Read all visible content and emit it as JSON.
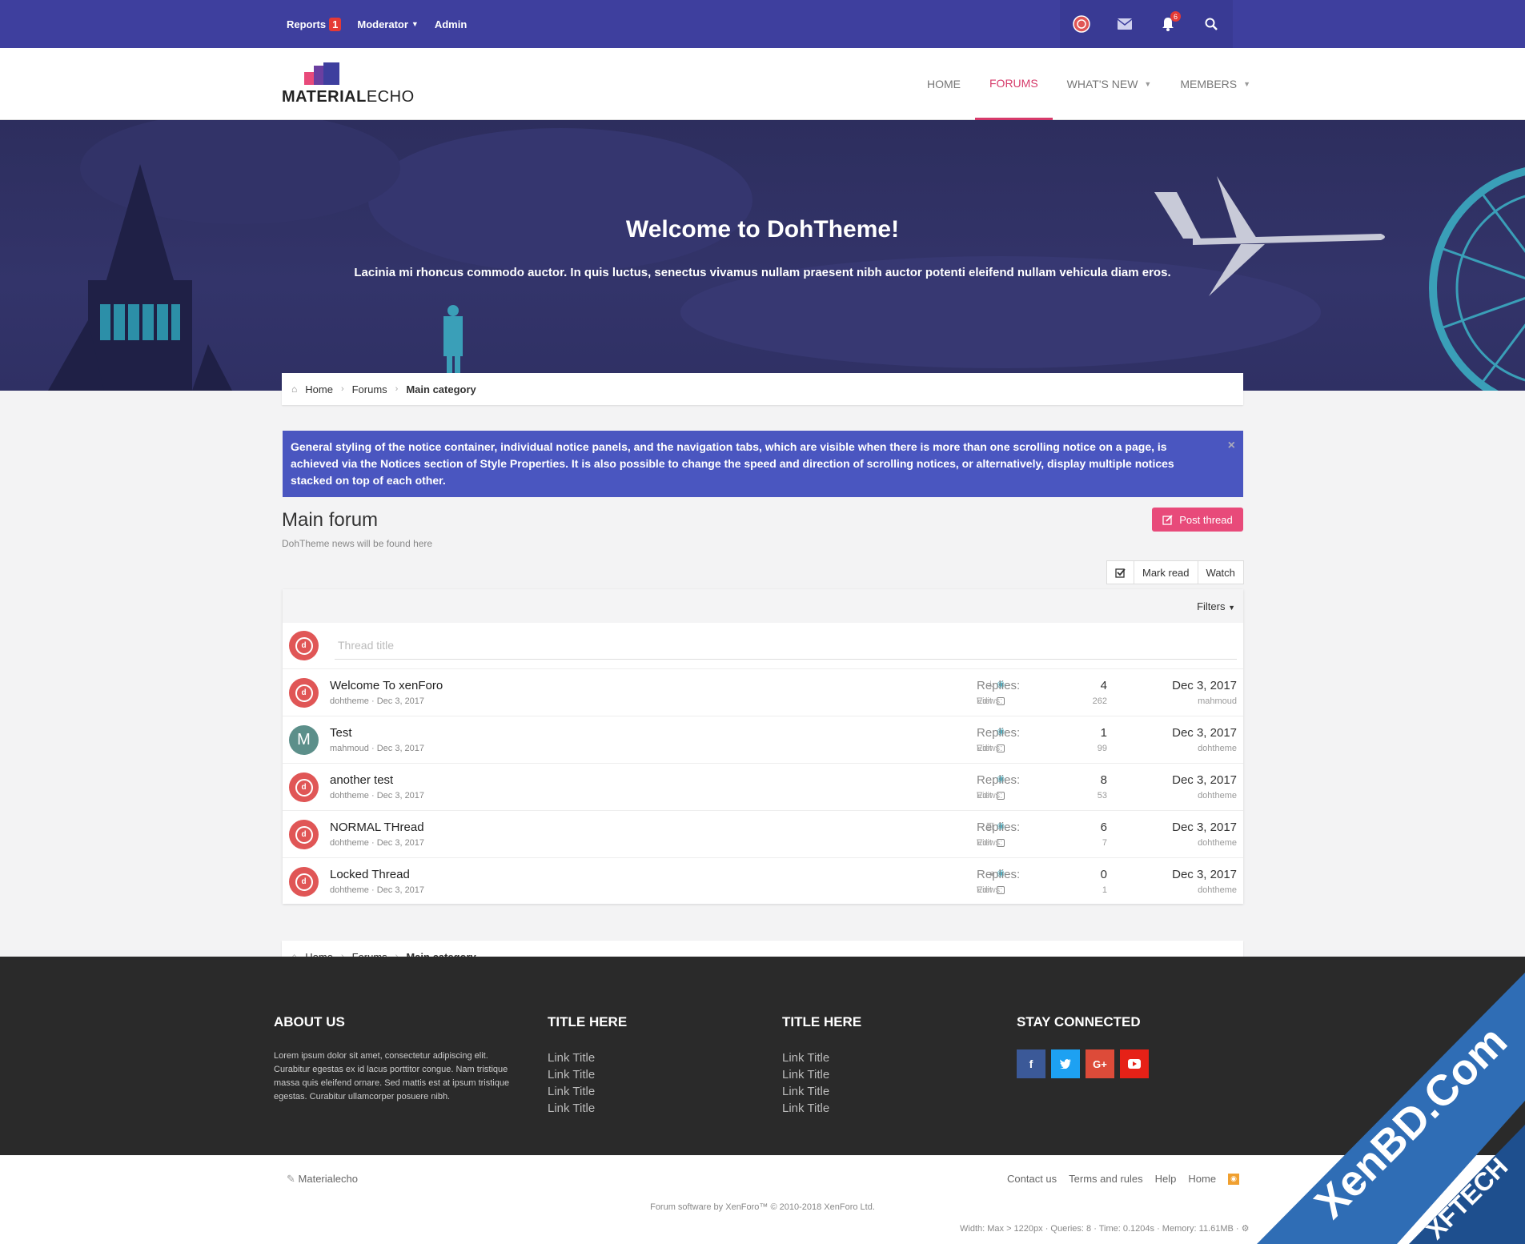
{
  "topbar": {
    "reports_label": "Reports",
    "reports_count": "1",
    "moderator_label": "Moderator",
    "admin_label": "Admin",
    "alerts_count": "6"
  },
  "logo": {
    "text_a": "MATERIAL",
    "text_b": "ECHO"
  },
  "nav": {
    "home": "HOME",
    "forums": "FORUMS",
    "whats_new": "WHAT'S NEW",
    "members": "MEMBERS"
  },
  "hero": {
    "title": "Welcome to DohTheme!",
    "subtitle": "Lacinia mi rhoncus commodo auctor. In quis luctus, senectus vivamus nullam praesent nibh auctor potenti eleifend nullam vehicula diam eros."
  },
  "breadcrumb": {
    "home": "Home",
    "forums": "Forums",
    "current": "Main category"
  },
  "notice": {
    "text": "General styling of the notice container, individual notice panels, and the navigation tabs, which are visible when there is more than one scrolling notice on a page, is achieved via the Notices section of Style Properties. It is also possible to change the speed and direction of scrolling notices, or alternatively, display multiple notices stacked on top of each other.",
    "close": "×"
  },
  "forum": {
    "title": "Main forum",
    "description": "DohTheme news will be found here",
    "post_thread": "Post thread",
    "mark_read": "Mark read",
    "watch": "Watch",
    "filters": "Filters",
    "thread_placeholder": "Thread title"
  },
  "labels": {
    "replies": "Replies:",
    "views": "Views:",
    "edit": "Edit"
  },
  "threads": [
    {
      "title": "Welcome To xenForo",
      "author": "dohtheme",
      "date": "Dec 3, 2017",
      "replies": "4",
      "views": "262",
      "last_date": "Dec 3, 2017",
      "last_user": "mahmoud",
      "avatar": "doh",
      "flag": "pin"
    },
    {
      "title": "Test",
      "author": "mahmoud",
      "date": "Dec 3, 2017",
      "replies": "1",
      "views": "99",
      "last_date": "Dec 3, 2017",
      "last_user": "dohtheme",
      "avatar": "M",
      "flag": ""
    },
    {
      "title": "another test",
      "author": "dohtheme",
      "date": "Dec 3, 2017",
      "replies": "8",
      "views": "53",
      "last_date": "Dec 3, 2017",
      "last_user": "dohtheme",
      "avatar": "doh",
      "flag": ""
    },
    {
      "title": "NORMAL THread",
      "author": "dohtheme",
      "date": "Dec 3, 2017",
      "replies": "6",
      "views": "7",
      "last_date": "Dec 3, 2017",
      "last_user": "dohtheme",
      "avatar": "doh",
      "flag": "poll"
    },
    {
      "title": "Locked Thread",
      "author": "dohtheme",
      "date": "Dec 3, 2017",
      "replies": "0",
      "views": "1",
      "last_date": "Dec 3, 2017",
      "last_user": "dohtheme",
      "avatar": "doh",
      "flag": "lock"
    }
  ],
  "footer": {
    "about_title": "ABOUT US",
    "about_text": "Lorem ipsum dolor sit amet, consectetur adipiscing elit. Curabitur egestas ex id lacus porttitor congue. Nam tristique massa quis eleifend ornare. Sed mattis est at ipsum tristique egestas. Curabitur ullamcorper posuere nibh.",
    "col2_title": "TITLE HERE",
    "col3_title": "TITLE HERE",
    "link": "Link Title",
    "stay_title": "STAY CONNECTED"
  },
  "bottom": {
    "brand": "Materialecho",
    "contact": "Contact us",
    "terms": "Terms and rules",
    "help": "Help",
    "home": "Home",
    "copyright": "Forum software by XenForo™ © 2010-2018 XenForo Ltd.",
    "debug": "Width: Max > 1220px · Queries: 8 · Time: 0.1204s · Memory: 11.61MB ·"
  },
  "watermark": {
    "main": "XenBD.Com",
    "sub": "XFTECH"
  },
  "colors": {
    "topbar": "#3e3f9e",
    "accent": "#d63a6a",
    "notice": "#4a56c0",
    "footer": "#2a2a2a"
  }
}
